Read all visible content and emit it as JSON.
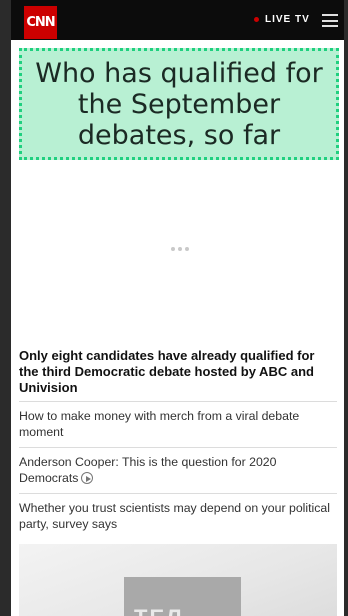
{
  "header": {
    "logo_text": "CNN",
    "live_label": "LIVE TV"
  },
  "hero": {
    "headline": "Who has qualified for the September debates, so far"
  },
  "article": {
    "lead_title": "Only eight candidates have already qualified for the third Democratic debate hosted by ABC and Univision"
  },
  "related": [
    {
      "title": "How to make money with merch from a viral debate moment"
    },
    {
      "title": "Anderson Cooper: This is the question for 2020 Democrats"
    },
    {
      "title": "Whether you trust scientists may depend on your political party, survey says"
    }
  ],
  "promo": {
    "card_text": "ТЕЛ"
  },
  "colors": {
    "brand_red": "#cc0000",
    "hero_bg": "#b8f0d3",
    "hero_border": "#1fd07f"
  }
}
